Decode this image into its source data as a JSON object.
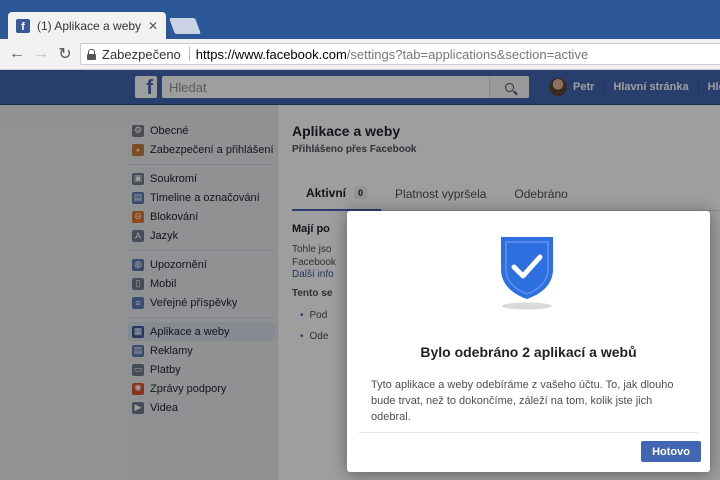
{
  "browser": {
    "tab_title": "(1) Aplikace a weby",
    "secure_label": "Zabezpečeno",
    "url_host": "https://www.facebook.com",
    "url_path": "/settings?tab=applications&section=active"
  },
  "fb_header": {
    "logo_letter": "f",
    "search_placeholder": "Hledat",
    "user_name": "Petr",
    "home_label": "Hlavní stránka",
    "find_friends_label": "Hledat"
  },
  "sidebar": {
    "groups": [
      [
        {
          "label": "Obecné",
          "icon": "gear-icon",
          "color": "#7a7f87"
        },
        {
          "label": "Zabezpečení a přihlášení",
          "icon": "badge-icon",
          "color": "#c77f3a"
        }
      ],
      [
        {
          "label": "Soukromí",
          "icon": "lock-icon",
          "color": "#6d7b8e"
        },
        {
          "label": "Timeline a označování",
          "icon": "timeline-icon",
          "color": "#5b7bb3"
        },
        {
          "label": "Blokování",
          "icon": "block-icon",
          "color": "#e0782b"
        },
        {
          "label": "Jazyk",
          "icon": "language-icon",
          "color": "#6d7b8e"
        }
      ],
      [
        {
          "label": "Upozornění",
          "icon": "globe-icon",
          "color": "#5b7bb3"
        },
        {
          "label": "Mobil",
          "icon": "mobile-icon",
          "color": "#6d7b8e"
        },
        {
          "label": "Veřejné příspěvky",
          "icon": "rss-icon",
          "color": "#5b7bb3"
        }
      ],
      [
        {
          "label": "Aplikace a weby",
          "icon": "apps-icon",
          "color": "#3b5998",
          "active": true
        },
        {
          "label": "Reklamy",
          "icon": "ads-icon",
          "color": "#5b7bb3"
        },
        {
          "label": "Platby",
          "icon": "payments-icon",
          "color": "#6d7b8e"
        },
        {
          "label": "Zprávy podpory",
          "icon": "support-icon",
          "color": "#d9542b"
        },
        {
          "label": "Videa",
          "icon": "video-icon",
          "color": "#6d7b8e"
        }
      ]
    ]
  },
  "content": {
    "title": "Aplikace a weby",
    "subtitle": "Přihlášeno přes Facebook",
    "tabs": [
      {
        "label": "Aktivní",
        "count": "0",
        "active": true
      },
      {
        "label": "Platnost vypršela"
      },
      {
        "label": "Odebráno"
      }
    ],
    "card_title": "Mají po",
    "card_line1": "Tohle jso",
    "card_line2": "Facebook",
    "card_link": "Další info",
    "card_section": "Tento se",
    "card_items": [
      "Pod",
      "Ode"
    ]
  },
  "modal": {
    "title": "Bylo odebráno 2 aplikací a webů",
    "body": "Tyto aplikace a weby odebíráme z vašeho účtu. To, jak dlouho bude trvat, než to dokončíme, záleží na tom, kolik jste jich odebral.",
    "done_label": "Hotovo",
    "shield_color": "#2d6ee0"
  },
  "colors": {
    "fb_blue": "#4267b2",
    "chrome_blue": "#2b5797"
  }
}
